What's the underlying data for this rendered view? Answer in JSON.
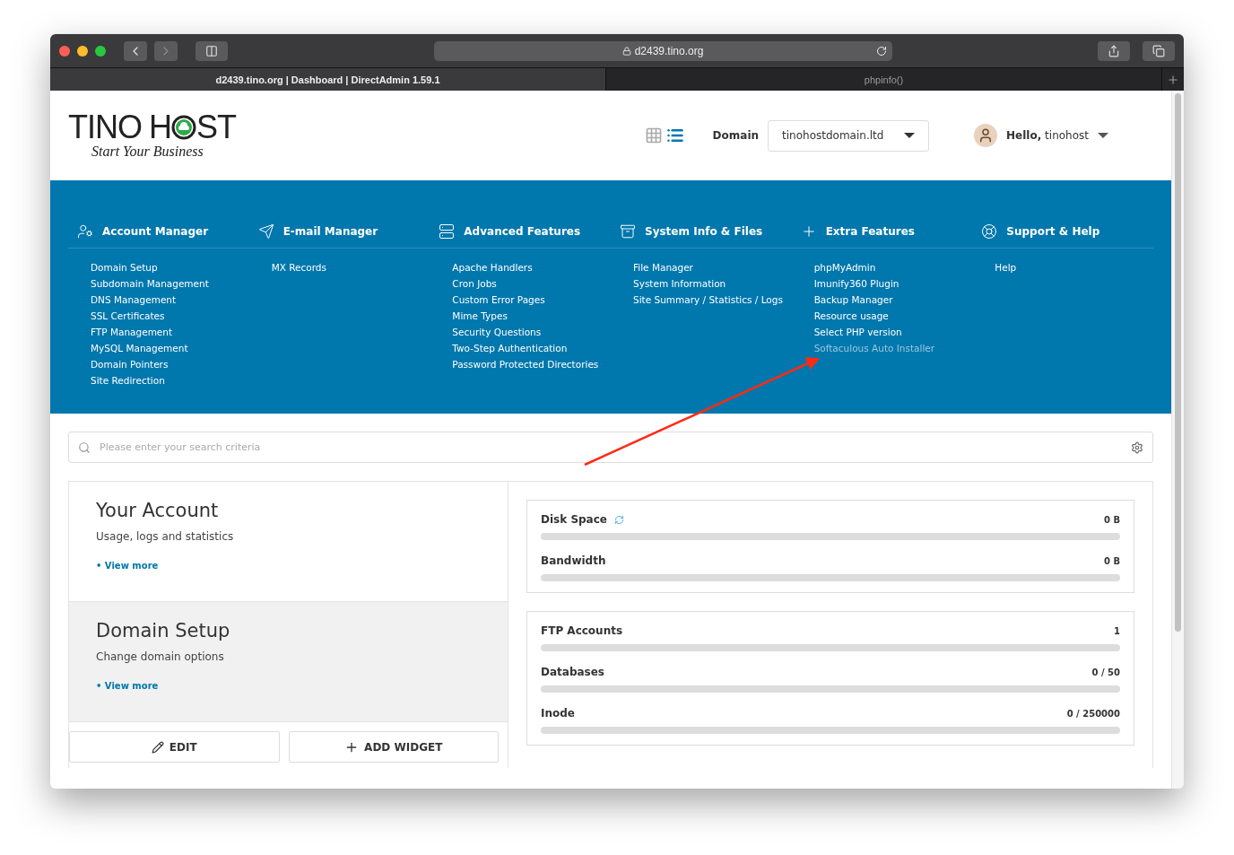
{
  "browser": {
    "address": "d2439.tino.org",
    "tabs": [
      {
        "title": "d2439.tino.org | Dashboard | DirectAdmin 1.59.1",
        "selected": true
      },
      {
        "title": "phpinfo()",
        "selected": false
      }
    ]
  },
  "header": {
    "logo": {
      "brand_left": "TINO",
      "brand_right": "H",
      "brand_end": "ST",
      "slogan": "Start Your Business"
    },
    "view_modes": [
      {
        "kind": "grid",
        "selected": false
      },
      {
        "kind": "list",
        "selected": true
      }
    ],
    "domain_label": "Domain",
    "domain_value": "tinohostdomain.ltd",
    "greeting": "**Hello,** tinohost"
  },
  "nav": [
    {
      "kind": "account",
      "title": "Account Manager",
      "items": [
        {
          "label": "Domain Setup",
          "highlighted": false
        },
        {
          "label": "Subdomain Management",
          "highlighted": false
        },
        {
          "label": "DNS Management",
          "highlighted": false
        },
        {
          "label": "SSL Certificates",
          "highlighted": false
        },
        {
          "label": "FTP Management",
          "highlighted": false
        },
        {
          "label": "MySQL Management",
          "highlighted": false
        },
        {
          "label": "Domain Pointers",
          "highlighted": false
        },
        {
          "label": "Site Redirection",
          "highlighted": false
        }
      ]
    },
    {
      "kind": "email",
      "title": "E-mail Manager",
      "items": [
        {
          "label": "MX Records",
          "highlighted": false
        }
      ]
    },
    {
      "kind": "advanced",
      "title": "Advanced Features",
      "items": [
        {
          "label": "Apache Handlers",
          "highlighted": false
        },
        {
          "label": "Cron Jobs",
          "highlighted": false
        },
        {
          "label": "Custom Error Pages",
          "highlighted": false
        },
        {
          "label": "Mime Types",
          "highlighted": false
        },
        {
          "label": "Security Questions",
          "highlighted": false
        },
        {
          "label": "Two-Step Authentication",
          "highlighted": false
        },
        {
          "label": "Password Protected Directories",
          "highlighted": false
        }
      ]
    },
    {
      "kind": "files",
      "title": "System Info & Files",
      "items": [
        {
          "label": "File Manager",
          "highlighted": false
        },
        {
          "label": "System Information",
          "highlighted": false
        },
        {
          "label": "Site Summary / Statistics / Logs",
          "highlighted": false
        }
      ]
    },
    {
      "kind": "extra",
      "title": "Extra Features",
      "items": [
        {
          "label": "phpMyAdmin",
          "highlighted": false
        },
        {
          "label": "Imunify360 Plugin",
          "highlighted": false
        },
        {
          "label": "Backup Manager",
          "highlighted": false
        },
        {
          "label": "Resource usage",
          "highlighted": false
        },
        {
          "label": "Select PHP version",
          "highlighted": false
        },
        {
          "label": "Softaculous Auto Installer",
          "highlighted": true
        }
      ]
    },
    {
      "kind": "support",
      "title": "Support & Help",
      "items": [
        {
          "label": "Help",
          "highlighted": false
        }
      ]
    }
  ],
  "search": {
    "placeholder": "Please enter your search criteria"
  },
  "cards": [
    {
      "title": "Your Account",
      "subtitle": "Usage, logs and statistics",
      "link": "• View more",
      "shaded": false
    },
    {
      "title": "Domain Setup",
      "subtitle": "Change domain options",
      "link": "• View more",
      "shaded": true
    }
  ],
  "buttons": [
    {
      "kind": "edit",
      "label": "EDIT"
    },
    {
      "kind": "add",
      "label": "ADD WIDGET"
    }
  ],
  "stat_groups": [
    [
      {
        "label": "Disk Space",
        "value": "0 B",
        "level": 0,
        "loading": true
      },
      {
        "label": "Bandwidth",
        "value": "0 B",
        "level": 0,
        "loading": false
      }
    ],
    [
      {
        "label": "FTP Accounts",
        "value": "1",
        "level": 0,
        "loading": false
      },
      {
        "label": "Databases",
        "value": "0 / 50",
        "level": 0,
        "loading": false
      },
      {
        "label": "Inode",
        "value": "0 / 250000",
        "level": 0,
        "loading": false
      }
    ]
  ]
}
